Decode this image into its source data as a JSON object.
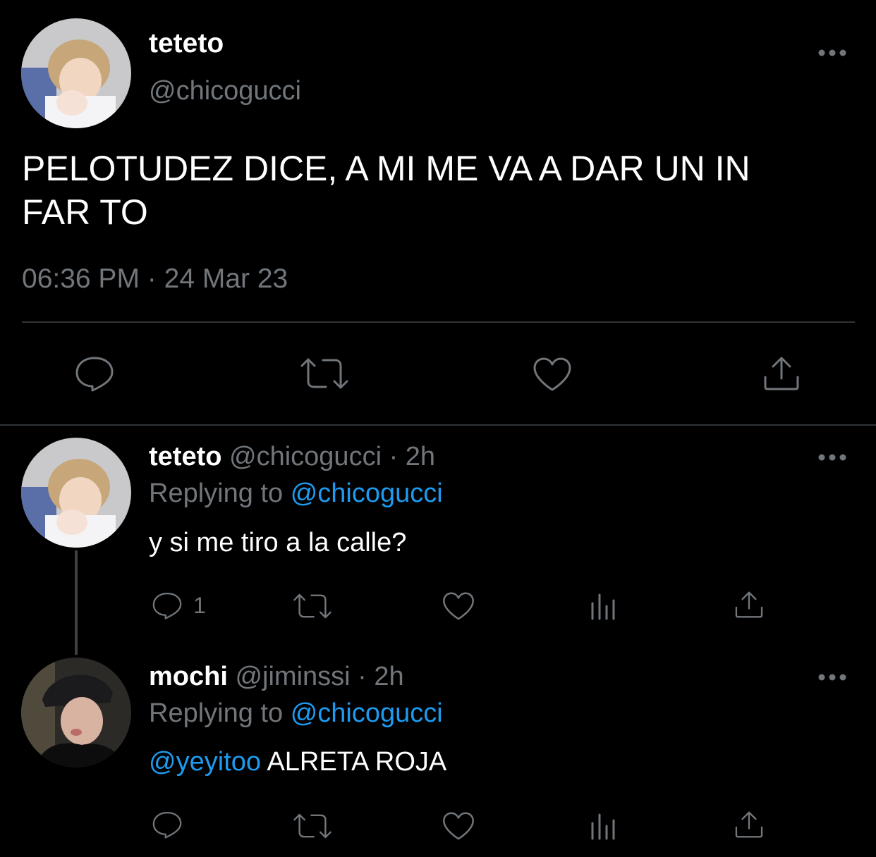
{
  "main_tweet": {
    "display_name": "teteto",
    "handle": "@chicogucci",
    "text_line1": "PELOTUDEZ DICE, A MI ME VA A DAR UN IN",
    "text_line2": "FAR TO",
    "time": "06:36 PM",
    "dot": "·",
    "date": "24 Mar 23",
    "more_icon": "more-horizontal-icon",
    "actions": [
      "reply-icon",
      "retweet-icon",
      "like-icon",
      "share-icon"
    ]
  },
  "replies": [
    {
      "display_name": "teteto",
      "handle": "@chicogucci",
      "age": "· 2h",
      "replying_label": "Replying to",
      "replying_handle": "@chicogucci",
      "text": "y si me tiro a la calle?",
      "mention": "",
      "reply_count": "1"
    },
    {
      "display_name": "mochi",
      "handle": "@jiminssi",
      "age": "· 2h",
      "replying_label": "Replying to",
      "replying_handle": "@chicogucci",
      "mention": "@yeyitoo",
      "text": "ALRETA ROJA",
      "reply_count": ""
    }
  ],
  "colors": {
    "background": "#000000",
    "text": "#ffffff",
    "muted": "#71767b",
    "link": "#1d9bf0",
    "divider": "#2f3336"
  }
}
